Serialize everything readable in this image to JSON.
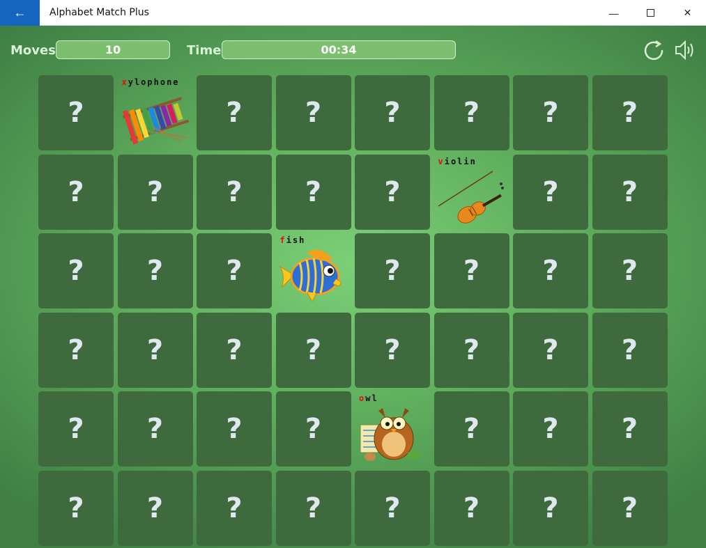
{
  "window": {
    "title": "Alphabet Match Plus",
    "back_icon": "back-arrow-icon",
    "minimize_icon": "minimize-icon",
    "maximize_icon": "maximize-icon",
    "close_icon": "close-icon"
  },
  "stats": {
    "moves_label": "Moves",
    "moves_value": "10",
    "time_label": "Time",
    "time_value": "00:34"
  },
  "controls": {
    "restart_icon": "restart-icon",
    "sound_icon": "speaker-icon"
  },
  "board": {
    "rows": 6,
    "cols": 8,
    "hidden_symbol": "?",
    "revealed": [
      {
        "row": 0,
        "col": 1,
        "word": "xylophone",
        "first": "x",
        "rest": "ylophone",
        "picture": "xylophone"
      },
      {
        "row": 1,
        "col": 5,
        "word": "violin",
        "first": "v",
        "rest": "iolin",
        "picture": "violin"
      },
      {
        "row": 2,
        "col": 3,
        "word": "fish",
        "first": "f",
        "rest": "ish",
        "picture": "fish"
      },
      {
        "row": 4,
        "col": 4,
        "word": "owl",
        "first": "o",
        "rest": "wl",
        "picture": "owl"
      }
    ]
  },
  "colors": {
    "card_hidden": "#3e6a3d",
    "letter_highlight": "#e01010",
    "title_accent": "#1565c0"
  }
}
